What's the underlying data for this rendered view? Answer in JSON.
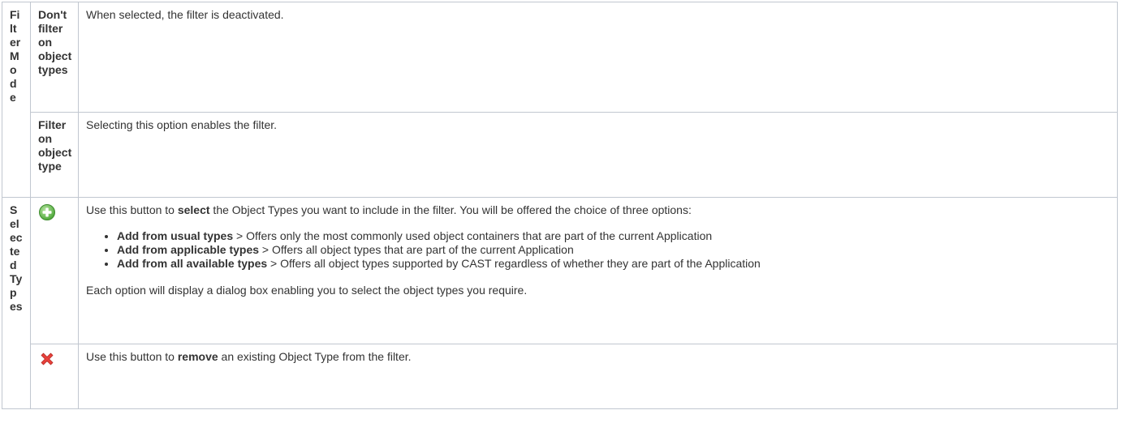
{
  "sections": {
    "filter_mode": {
      "label": "Filter Mode",
      "rows": [
        {
          "option": "Don't filter on object types",
          "description": "When selected, the filter is deactivated."
        },
        {
          "option": "Filter on object type",
          "description": "Selecting this option enables the filter."
        }
      ]
    },
    "selected_types": {
      "label": "Selected Types",
      "add": {
        "icon": "add-icon",
        "intro_before": "Use this button to ",
        "intro_bold": "select",
        "intro_after": " the Object Types you want to include in the filter. You will be offered the choice of three options:",
        "options": [
          {
            "title": "Add from usual types",
            "text": " > Offers only the most commonly used object containers that are part of the current Application"
          },
          {
            "title": "Add from applicable types",
            "text": " > Offers all object types that are part of the current Application"
          },
          {
            "title": "Add from all available types",
            "text": " > Offers all object types supported by CAST regardless of whether they are part of the Application"
          }
        ],
        "footer": "Each option will display a dialog box enabling you to select the object types you require."
      },
      "remove": {
        "icon": "remove-icon",
        "text_before": "Use this button to ",
        "text_bold": "remove",
        "text_after": " an existing Object Type from the filter."
      }
    }
  },
  "colors": {
    "add_green": "#6cc24a",
    "remove_red": "#e8413c",
    "border": "#c1c7d0"
  }
}
